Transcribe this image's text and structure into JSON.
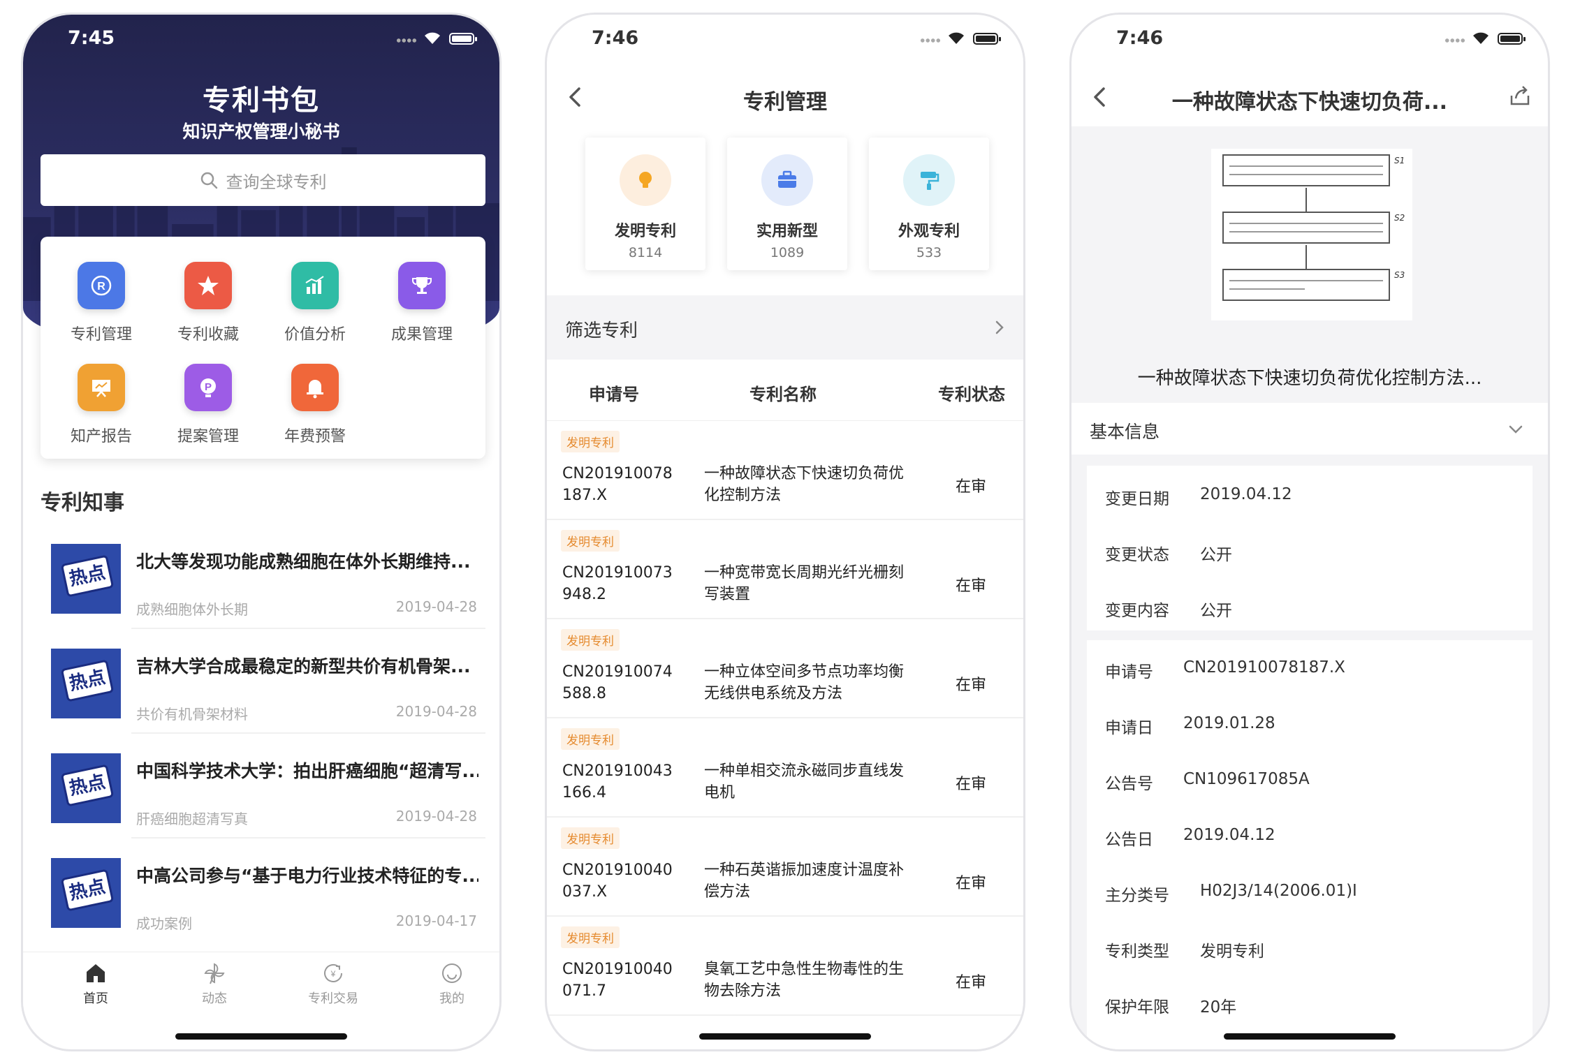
{
  "phone1": {
    "status_time": "7:45",
    "app_title": "专利书包",
    "app_subtitle": "知识产权管理小秘书",
    "search_placeholder": "查询全球专利",
    "grid_items": [
      {
        "label": "专利管理",
        "icon": "registered-icon",
        "color": "#4c78e6"
      },
      {
        "label": "专利收藏",
        "icon": "star-icon",
        "color": "#ec5a45"
      },
      {
        "label": "价值分析",
        "icon": "chart-icon",
        "color": "#2fbca5"
      },
      {
        "label": "成果管理",
        "icon": "trophy-icon",
        "color": "#8a5be8"
      },
      {
        "label": "知产报告",
        "icon": "presentation-icon",
        "color": "#f0a133"
      },
      {
        "label": "提案管理",
        "icon": "proposal-icon",
        "color": "#9d5ce6"
      },
      {
        "label": "年费预警",
        "icon": "bell-icon",
        "color": "#f0673a"
      }
    ],
    "section_title": "专利知事",
    "thumb_label": "热点",
    "news": [
      {
        "title": "北大等发现功能成熟细胞在体外长期维持...",
        "meta": "成熟细胞体外长期",
        "date": "2019-04-28"
      },
      {
        "title": "吉林大学合成最稳定的新型共价有机骨架...",
        "meta": "共价有机骨架材料",
        "date": "2019-04-28"
      },
      {
        "title": "中国科学技术大学：拍出肝癌细胞“超清写...",
        "meta": "肝癌细胞超清写真",
        "date": "2019-04-28"
      },
      {
        "title": "中高公司参与“基于电力行业技术特征的专...",
        "meta": "成功案例",
        "date": "2019-04-17"
      }
    ],
    "tabs": [
      {
        "label": "首页",
        "icon": "home-icon"
      },
      {
        "label": "动态",
        "icon": "pinwheel-icon"
      },
      {
        "label": "专利交易",
        "icon": "trade-icon"
      },
      {
        "label": "我的",
        "icon": "smile-icon"
      }
    ]
  },
  "phone2": {
    "status_time": "7:46",
    "nav_title": "专利管理",
    "stats": [
      {
        "label": "发明专利",
        "count": "8114",
        "icon": "bulb-icon",
        "color": "#f5a623",
        "bg": "#fdeede"
      },
      {
        "label": "实用新型",
        "count": "1089",
        "icon": "toolbox-icon",
        "color": "#4a7be8",
        "bg": "#e3ebfb"
      },
      {
        "label": "外观专利",
        "count": "533",
        "icon": "paint-roller-icon",
        "color": "#3bb3d9",
        "bg": "#e0f3f8"
      }
    ],
    "filter_label": "筛选专利",
    "columns": {
      "num": "申请号",
      "name": "专利名称",
      "status": "专利状态"
    },
    "rows": [
      {
        "tag": "发明专利",
        "num": "CN201910078187.X",
        "name": "一种故障状态下快速切负荷优化控制方法",
        "status": "在审"
      },
      {
        "tag": "发明专利",
        "num": "CN201910073948.2",
        "name": "一种宽带宽长周期光纤光栅刻写装置",
        "status": "在审"
      },
      {
        "tag": "发明专利",
        "num": "CN201910074588.8",
        "name": "一种立体空间多节点功率均衡无线供电系统及方法",
        "status": "在审"
      },
      {
        "tag": "发明专利",
        "num": "CN201910043166.4",
        "name": "一种单相交流永磁同步直线发电机",
        "status": "在审"
      },
      {
        "tag": "发明专利",
        "num": "CN201910040037.X",
        "name": "一种石英谐振加速度计温度补偿方法",
        "status": "在审"
      },
      {
        "tag": "发明专利",
        "num": "CN201910040071.7",
        "name": "臭氧工艺中急性生物毒性的生物去除方法",
        "status": "在审"
      }
    ]
  },
  "phone3": {
    "status_time": "7:46",
    "nav_title": "一种故障状态下快速切负荷...",
    "figure_labels": [
      "S1",
      "S2",
      "S3"
    ],
    "figure_caption": "一种故障状态下快速切负荷优化控制方法...",
    "info_header": "基本信息",
    "change_info": [
      {
        "k": "变更日期",
        "v": "2019.04.12"
      },
      {
        "k": "变更状态",
        "v": "公开"
      },
      {
        "k": "变更内容",
        "v": "公开"
      }
    ],
    "basic_info": [
      {
        "k": "申请号",
        "v": "CN201910078187.X"
      },
      {
        "k": "申请日",
        "v": "2019.01.28"
      },
      {
        "k": "公告号",
        "v": "CN109617085A"
      },
      {
        "k": "公告日",
        "v": "2019.04.12"
      },
      {
        "k": "主分类号",
        "v": "H02J3/14(2006.01)I"
      },
      {
        "k": "专利类型",
        "v": "发明专利"
      },
      {
        "k": "保护年限",
        "v": "20年"
      }
    ]
  }
}
